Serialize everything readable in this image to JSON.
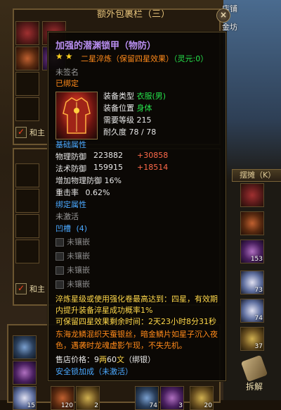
{
  "bag": {
    "title": "额外包裹栏（三）",
    "close": "×",
    "checkbox_top_label": "和主",
    "checkbox_mid_label": "和主",
    "checkbox_mark": "✓",
    "slot_counts": [
      "153",
      "73",
      "74",
      "37",
      "15",
      "120",
      "2",
      "74",
      "3",
      "20"
    ]
  },
  "right_panel": {
    "shop": "店铺",
    "gold": "金坊",
    "stall": "摆摊（K）",
    "decompose": "拆解"
  },
  "tooltip": {
    "title": "加强的潜渊锁甲（物防）",
    "stars": "★★",
    "star_level": "二星淬炼（保留四星效果）",
    "spirit": "（灵元:0）",
    "unsigned": "未签名",
    "bound": "已绑定",
    "equip_type_label": "装备类型",
    "equip_type_value": "衣服(男)",
    "equip_pos_label": "装备位置",
    "equip_pos_value": "身体",
    "level_label": "需要等级",
    "level_value": "215",
    "durability_label": "耐久度",
    "durability_value": "78 / 78",
    "base_header": "基础属性",
    "phys_def_label": "物理防御",
    "phys_def_value": "223882",
    "phys_def_bonus": "+30858",
    "magic_def_label": "法术防御",
    "magic_def_value": "159915",
    "magic_def_bonus": "+18514",
    "phys_def_pct": "增加物理防御 16%",
    "crit_label": "重击率",
    "crit_value": "0.62%",
    "bind_header": "绑定属性",
    "not_activated": "未激活",
    "groove_header": "凹槽",
    "groove_count": "(4)",
    "gem_empty": "未镶嵌",
    "refine_text": "淬炼星级或使用强化卷最高达到：四星，有效期内提升装备淬星成功概率1%",
    "keep_star_text": "可保留四星效果剩余时间：2天23小时8分31秒",
    "lore_text": "东海龙鳞混织天蚕银丝，暗金鳞片如星子沉入夜色，遇袭时龙魂虚影乍现，不失先机。",
    "price_label": "售店价格：",
    "price_gold": "9",
    "price_gold_unit": "两",
    "price_silver": "60",
    "price_silver_unit": "文",
    "price_bind": "（绑银）",
    "lock_label": "安全锁加成",
    "lock_value": "（未激活）"
  }
}
